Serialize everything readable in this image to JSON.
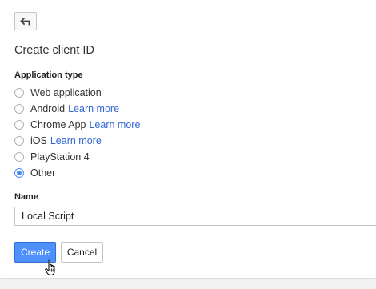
{
  "back_button": {
    "icon": "back-arrow-icon"
  },
  "page_title": "Create client ID",
  "application_type": {
    "label": "Application type",
    "options": [
      {
        "label": "Web application",
        "link": "",
        "checked": false
      },
      {
        "label": "Android",
        "link": "Learn more",
        "checked": false
      },
      {
        "label": "Chrome App",
        "link": "Learn more",
        "checked": false
      },
      {
        "label": "iOS",
        "link": "Learn more",
        "checked": false
      },
      {
        "label": "PlayStation 4",
        "link": "",
        "checked": false
      },
      {
        "label": "Other",
        "link": "",
        "checked": true
      }
    ]
  },
  "name": {
    "label": "Name",
    "value": "Local Script"
  },
  "actions": {
    "create_label": "Create",
    "cancel_label": "Cancel"
  },
  "colors": {
    "primary_button": "#4d90fe",
    "link": "#3367d6",
    "radio_selected": "#4a8ef2"
  }
}
